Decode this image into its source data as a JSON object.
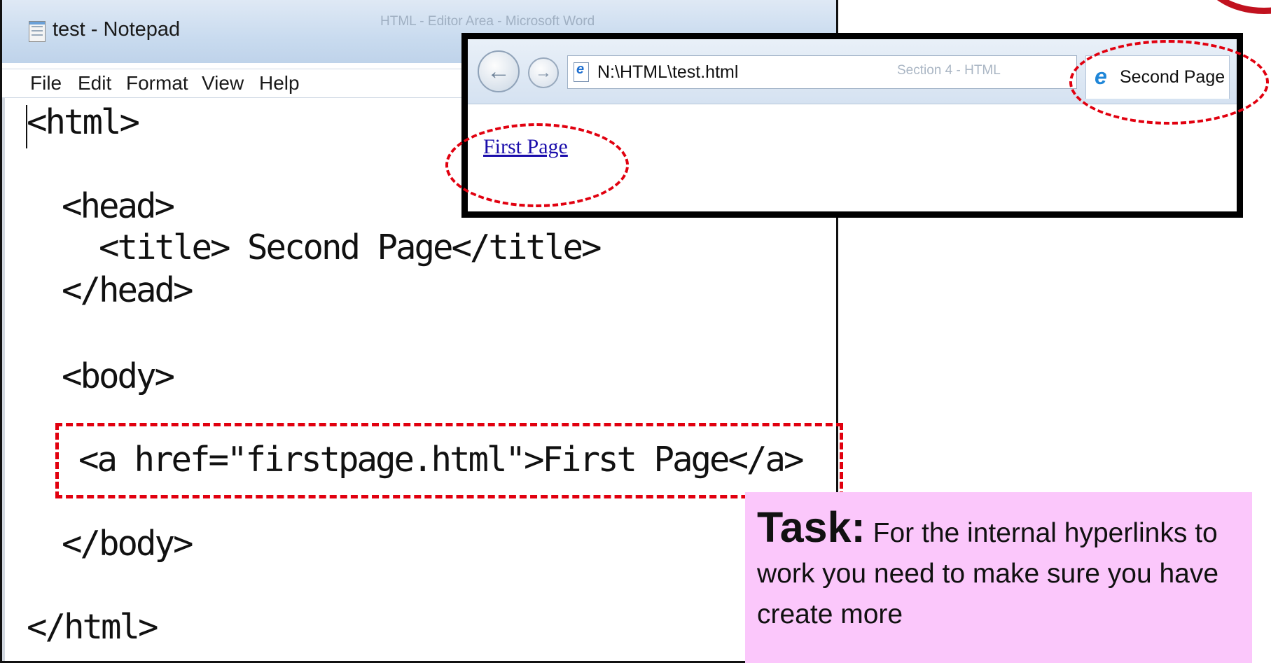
{
  "notepad": {
    "title": "test - Notepad",
    "ghost_title": "HTML - Editor Area - Microsoft Word",
    "menu": [
      {
        "label": "File"
      },
      {
        "label": "Edit"
      },
      {
        "label": "Format"
      },
      {
        "label": "View"
      },
      {
        "label": "Help"
      }
    ],
    "code_lines": [
      "<html>",
      "<head>",
      "<title> Second Page</title>",
      "</head>",
      "<body>",
      "<a href=\"firstpage.html\">First Page</a>",
      "</body>",
      "</html>"
    ]
  },
  "browser": {
    "url": "N:\\HTML\\test.html",
    "ghost_address": "Section 4 - HTML",
    "tab_title": "Second Page",
    "link_text": "First Page",
    "icons": [
      "back-arrow-icon",
      "forward-arrow-icon",
      "ie-page-icon",
      "search-icon",
      "refresh-icon",
      "ie-logo-icon"
    ]
  },
  "task": {
    "label": "Task:",
    "text": " For the internal hyperlinks to work you need to make sure you have create more"
  },
  "colors": {
    "highlight": "#e1000f",
    "task_background": "#fbc7fb",
    "link": "#1a0dab"
  }
}
